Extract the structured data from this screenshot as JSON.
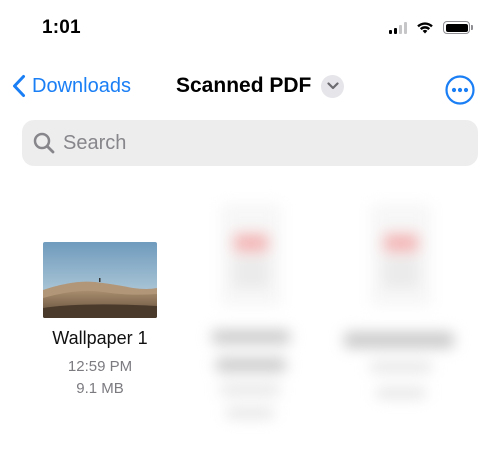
{
  "status_bar": {
    "time": "1:01"
  },
  "nav": {
    "back_label": "Downloads",
    "title": "Scanned PDF"
  },
  "search": {
    "placeholder": "Search",
    "value": ""
  },
  "files": [
    {
      "name": "Wallpaper 1",
      "time": "12:59 PM",
      "size": "9.1 MB"
    }
  ],
  "colors": {
    "accent": "#1a7ef5",
    "search_bg": "#ededee",
    "secondary_text": "#7b7b80"
  },
  "icons": {
    "back": "chevron-left-icon",
    "title_menu": "chevron-down-icon",
    "more": "ellipsis-circle-icon",
    "search": "magnifying-glass-icon"
  }
}
